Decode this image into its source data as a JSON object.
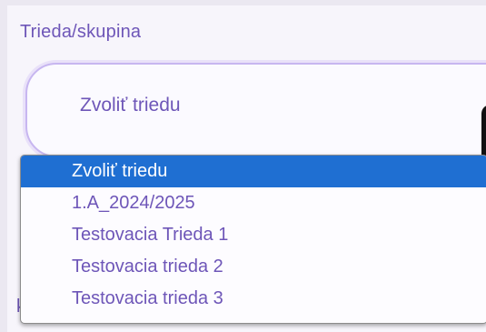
{
  "field": {
    "label": "Trieda/skupina",
    "value": "Zvoliť triedu"
  },
  "dropdown": {
    "options": [
      {
        "label": "Zvoliť triedu",
        "selected": true
      },
      {
        "label": "1.A_2024/2025",
        "selected": false
      },
      {
        "label": "Testovacia Trieda 1",
        "selected": false
      },
      {
        "label": "Testovacia trieda 2",
        "selected": false
      },
      {
        "label": "Testovacia trieda 3",
        "selected": false
      }
    ]
  },
  "behind": {
    "partial_text": "k"
  },
  "colors": {
    "accent": "#6e56b8",
    "selection": "#1f6fd2",
    "border": "#c7b6f0"
  }
}
